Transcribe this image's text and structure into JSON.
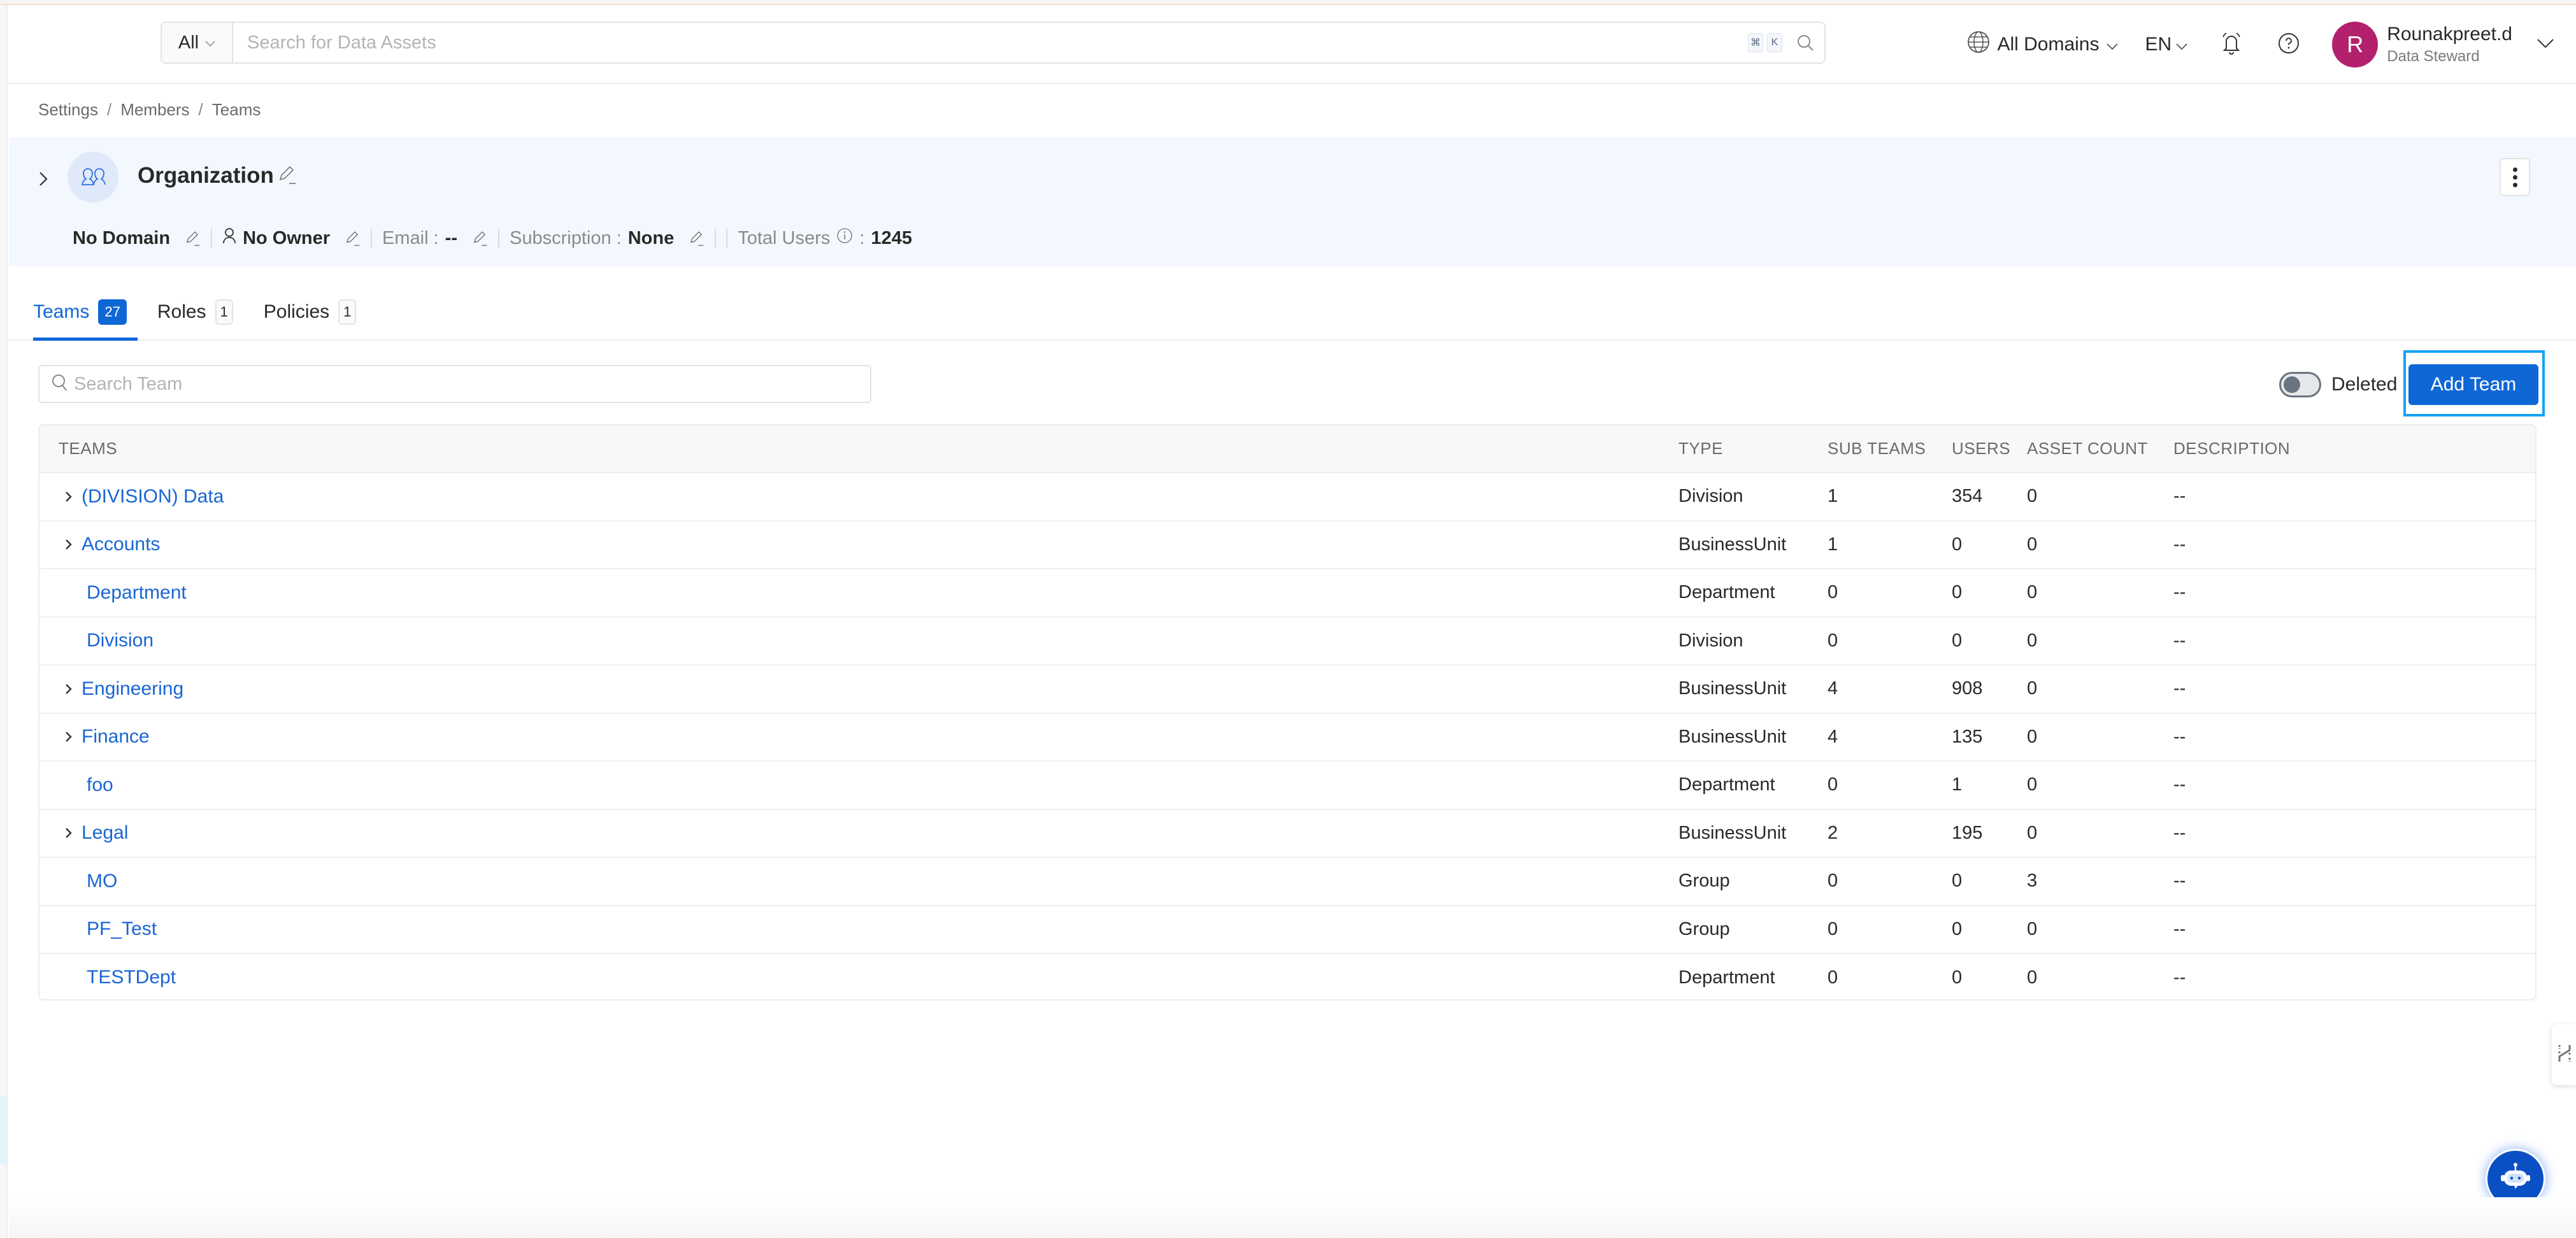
{
  "header": {
    "search_scope": "All",
    "search_placeholder": "Search for Data Assets",
    "shortcut_keys": [
      "⌘",
      "K"
    ],
    "domains_label": "All Domains",
    "language": "EN",
    "user": {
      "initial": "R",
      "name": "Rounakpreet.d",
      "role": "Data Steward",
      "avatar_color": "#b3206c"
    }
  },
  "breadcrumb": [
    "Settings",
    "Members",
    "Teams"
  ],
  "organization": {
    "name": "Organization",
    "domain": "No Domain",
    "owner": "No Owner",
    "email_label": "Email :",
    "email_value": "--",
    "subscription_label": "Subscription :",
    "subscription_value": "None",
    "total_users_label": "Total Users",
    "total_users_value": "1245"
  },
  "tabs": [
    {
      "label": "Teams",
      "count": "27",
      "active": true
    },
    {
      "label": "Roles",
      "count": "1",
      "active": false
    },
    {
      "label": "Policies",
      "count": "1",
      "active": false
    }
  ],
  "toolbar": {
    "search_placeholder": "Search Team",
    "deleted_label": "Deleted",
    "deleted_on": false,
    "add_team_label": "Add Team"
  },
  "table": {
    "columns": [
      "TEAMS",
      "TYPE",
      "SUB TEAMS",
      "USERS",
      "ASSET COUNT",
      "DESCRIPTION"
    ],
    "rows": [
      {
        "name": "(DIVISION) Data",
        "expandable": true,
        "type": "Division",
        "sub_teams": "1",
        "users": "354",
        "asset_count": "0",
        "description": "--"
      },
      {
        "name": "Accounts",
        "expandable": true,
        "type": "BusinessUnit",
        "sub_teams": "1",
        "users": "0",
        "asset_count": "0",
        "description": "--"
      },
      {
        "name": "Department",
        "expandable": false,
        "type": "Department",
        "sub_teams": "0",
        "users": "0",
        "asset_count": "0",
        "description": "--"
      },
      {
        "name": "Division",
        "expandable": false,
        "type": "Division",
        "sub_teams": "0",
        "users": "0",
        "asset_count": "0",
        "description": "--"
      },
      {
        "name": "Engineering",
        "expandable": true,
        "type": "BusinessUnit",
        "sub_teams": "4",
        "users": "908",
        "asset_count": "0",
        "description": "--"
      },
      {
        "name": "Finance",
        "expandable": true,
        "type": "BusinessUnit",
        "sub_teams": "4",
        "users": "135",
        "asset_count": "0",
        "description": "--"
      },
      {
        "name": "foo",
        "expandable": false,
        "type": "Department",
        "sub_teams": "0",
        "users": "1",
        "asset_count": "0",
        "description": "--"
      },
      {
        "name": "Legal",
        "expandable": true,
        "type": "BusinessUnit",
        "sub_teams": "2",
        "users": "195",
        "asset_count": "0",
        "description": "--"
      },
      {
        "name": "MO",
        "expandable": false,
        "type": "Group",
        "sub_teams": "0",
        "users": "0",
        "asset_count": "3",
        "description": "--"
      },
      {
        "name": "PF_Test",
        "expandable": false,
        "type": "Group",
        "sub_teams": "0",
        "users": "0",
        "asset_count": "0",
        "description": "--"
      },
      {
        "name": "TESTDept",
        "expandable": false,
        "type": "Department",
        "sub_teams": "0",
        "users": "0",
        "asset_count": "0",
        "description": "--"
      }
    ]
  },
  "colors": {
    "primary": "#0f67d6",
    "link": "#1a66d4",
    "org_panel_bg": "#f3f8fe",
    "focus_ring": "#12a3f5"
  }
}
